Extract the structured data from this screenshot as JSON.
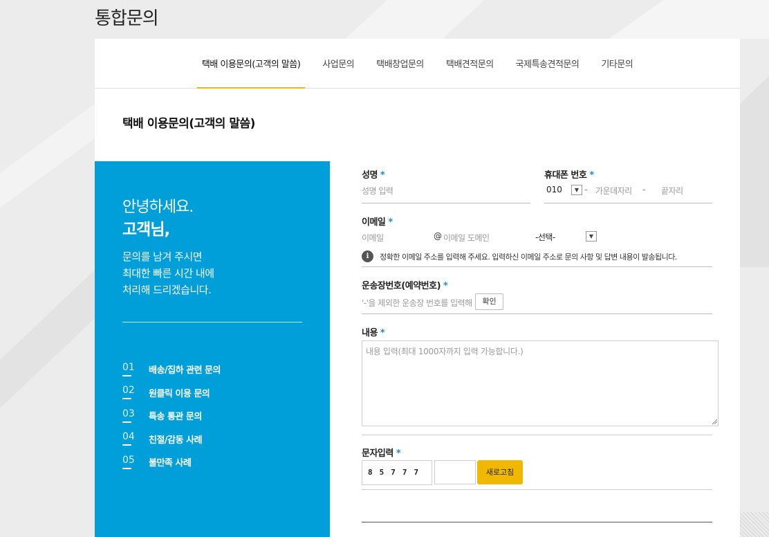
{
  "page_title": "통합문의",
  "tabs": [
    {
      "label": "택배 이용문의(고객의 말씀)",
      "active": true
    },
    {
      "label": "사업문의"
    },
    {
      "label": "택배창업문의"
    },
    {
      "label": "택배견적문의"
    },
    {
      "label": "국제특송견적문의"
    },
    {
      "label": "기타문의"
    }
  ],
  "section_title": "택배 이용문의(고객의 말씀)",
  "greeting": {
    "line1": "안녕하세요.",
    "line2": "고객님,",
    "desc": [
      "문의를 남겨 주시면",
      "최대한 빠른 시간 내에",
      "처리해 드리겠습니다."
    ]
  },
  "topics": [
    {
      "num": "01",
      "label": "배송/집하 관련 문의"
    },
    {
      "num": "02",
      "label": "원클릭 이용 문의"
    },
    {
      "num": "03",
      "label": "특송 통관 문의"
    },
    {
      "num": "04",
      "label": "친절/감동 사례"
    },
    {
      "num": "05",
      "label": "불만족 사례"
    }
  ],
  "form": {
    "required_mark": "*",
    "name": {
      "label": "성명",
      "placeholder": "성명 입력"
    },
    "phone": {
      "label": "휴대폰 번호",
      "prefix": "010",
      "dash": "-",
      "middle_placeholder": "가운데자리",
      "last_placeholder": "끝자리"
    },
    "email": {
      "label": "이메일",
      "id_placeholder": "이메일",
      "at": "@",
      "domain_placeholder": "이메일 도메인",
      "select_value": "-선택-"
    },
    "email_notice": "정확한 이메일 주소를 입력해 주세요. 입력하신 이메일 주소로 문의 사항 및 답변 내용이 발송됩니다.",
    "waybill": {
      "label": "운송장번호(예약번호)",
      "placeholder": "'-'을 제외한 운송장 번호를 입력해",
      "confirm_label": "확인"
    },
    "content": {
      "label": "내용",
      "placeholder": "내용 입력(최대 1000자까지 입력 가능합니다.)"
    },
    "captcha": {
      "label": "문자입력",
      "code": "85777",
      "refresh_label": "새로고침"
    }
  },
  "colors": {
    "accent": "#f0b800",
    "panel": "#009fd9",
    "required": "#1a8fc9"
  }
}
